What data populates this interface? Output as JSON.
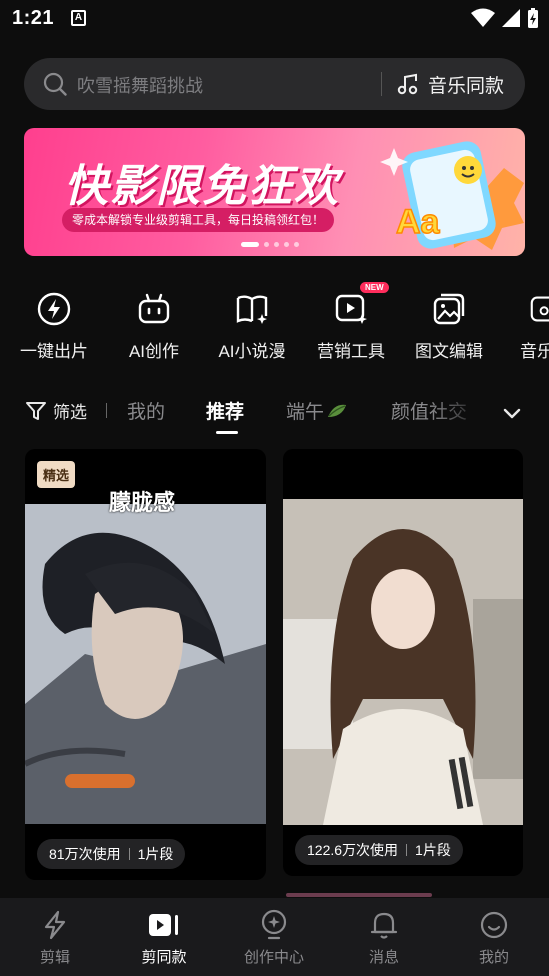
{
  "status_bar": {
    "time": "1:21",
    "notif_icon_letter": "A"
  },
  "search": {
    "placeholder": "吹雪摇舞蹈挑战",
    "music_label": "音乐同款"
  },
  "banner": {
    "title": "快影限免狂欢",
    "subtitle": "零成本解锁专业级剪辑工具，每日投稿领红包！",
    "art_text": "Aa",
    "dots": 5,
    "active_dot": 0
  },
  "shortcuts": [
    {
      "label": "一键出片",
      "icon": "lightning-icon"
    },
    {
      "label": "AI创作",
      "icon": "robot-icon"
    },
    {
      "label": "AI小说漫",
      "icon": "book-sparkle-icon"
    },
    {
      "label": "营销工具",
      "icon": "play-sparkle-icon",
      "badge": "NEW"
    },
    {
      "label": "图文编辑",
      "icon": "image-edit-icon"
    },
    {
      "label": "音乐",
      "icon": "music-icon"
    }
  ],
  "filter_label": "筛选",
  "tabs": [
    {
      "label": "我的",
      "active": false
    },
    {
      "label": "推荐",
      "active": true
    },
    {
      "label": "端午",
      "active": false
    },
    {
      "label": "颜值社交",
      "active": false
    }
  ],
  "cards": [
    {
      "badge": "精选",
      "caption": "朦胧感",
      "uses": "81万次使用",
      "clips": "1片段"
    },
    {
      "badge": "",
      "caption": "",
      "uses": "122.6万次使用",
      "clips": "1片段"
    }
  ],
  "nav": [
    {
      "label": "剪辑",
      "icon": "lightning-outline-icon",
      "active": false
    },
    {
      "label": "剪同款",
      "icon": "template-play-icon",
      "active": true
    },
    {
      "label": "创作中心",
      "icon": "bulb-icon",
      "active": false
    },
    {
      "label": "消息",
      "icon": "bell-icon",
      "active": false
    },
    {
      "label": "我的",
      "icon": "smiley-icon",
      "active": false
    }
  ],
  "colors": {
    "accent_pink": "#ff3f8e",
    "background": "#0d0d0d",
    "badge_bg": "#f0dbc4"
  }
}
